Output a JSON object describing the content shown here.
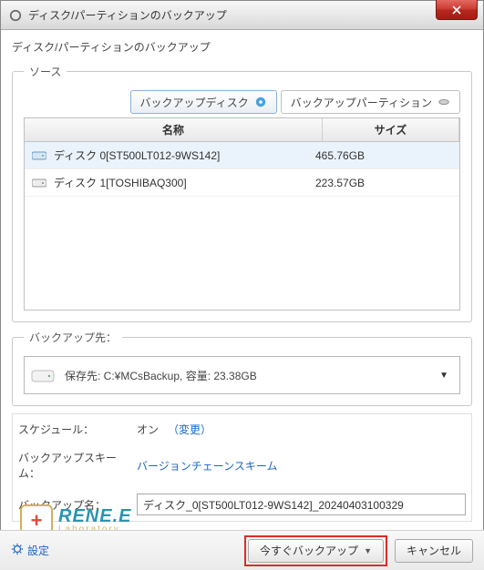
{
  "window": {
    "title": "ディスク/パーティションのバックアップ"
  },
  "heading": "ディスク/パーティションのバックアップ",
  "source": {
    "legend": "ソース",
    "tabs": {
      "disk": "バックアップディスク",
      "partition": "バックアップパーティション"
    },
    "columns": {
      "name": "名称",
      "size": "サイズ"
    },
    "rows": [
      {
        "name": "ディスク 0[ST500LT012-9WS142]",
        "size": "465.76GB",
        "selected": true
      },
      {
        "name": "ディスク 1[TOSHIBAQ300]",
        "size": "223.57GB",
        "selected": false
      }
    ]
  },
  "destination": {
    "legend": "バックアップ先：",
    "text": "保存先: C:¥MCsBackup, 容量: 23.38GB"
  },
  "schedule": {
    "label": "スケジュール：",
    "value": "オン",
    "change": "（変更）"
  },
  "scheme": {
    "label": "バックアップスキーム：",
    "value": "バージョンチェーンスキーム"
  },
  "backup_name": {
    "label": "バックアップ名：",
    "value": "ディスク_0[ST500LT012-9WS142]_20240403100329"
  },
  "logo": {
    "main": "RENE.E",
    "sub": "Laboratory"
  },
  "footer": {
    "settings": "設定",
    "backup_now": "今すぐバックアップ",
    "cancel": "キャンセル"
  }
}
